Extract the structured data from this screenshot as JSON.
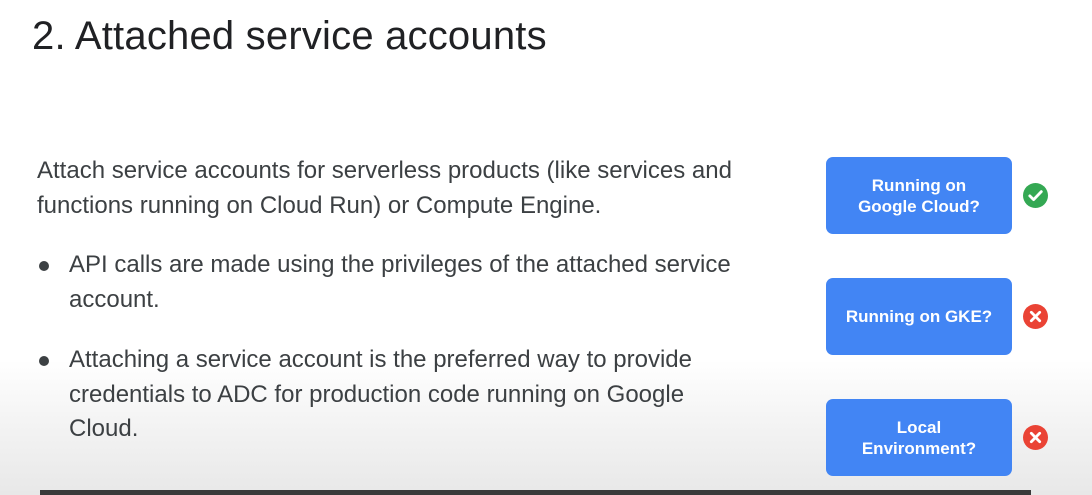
{
  "slide": {
    "title": "2. Attached service accounts",
    "intro": "Attach service accounts for serverless products (like services and functions running on Cloud Run) or Compute Engine.",
    "bullets": [
      "API calls are made using the privileges of the attached service account.",
      "Attaching a service account is the preferred way to provide credentials to ADC for production code running on Google Cloud."
    ]
  },
  "decision_flow": [
    {
      "label": "Running on Google Cloud?",
      "status": "yes",
      "icon": "check-circle-icon"
    },
    {
      "label": "Running on GKE?",
      "status": "no",
      "icon": "x-circle-icon"
    },
    {
      "label": "Local Environment?",
      "status": "no",
      "icon": "x-circle-icon"
    }
  ],
  "colors": {
    "card_blue": "#4285f4",
    "check_green": "#34a853",
    "cross_red": "#ea4335",
    "text_dark": "#3c4043"
  }
}
